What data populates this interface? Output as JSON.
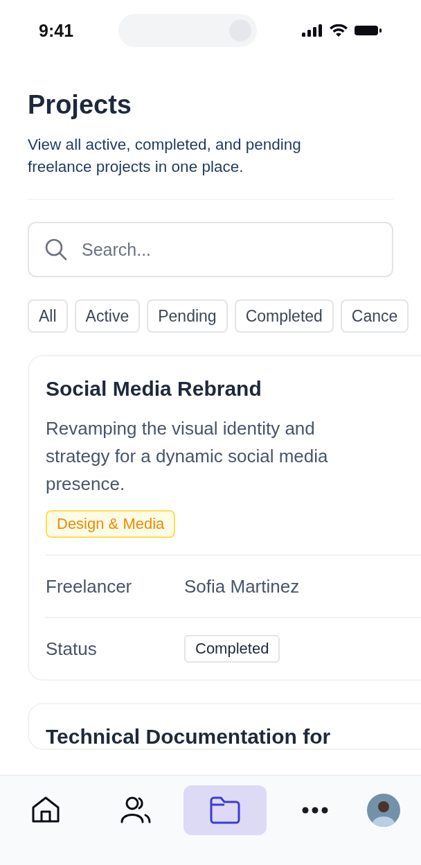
{
  "status_bar": {
    "time": "9:41"
  },
  "header": {
    "title": "Projects",
    "subtitle": "View all active, completed, and pending freelance projects in one place."
  },
  "search": {
    "placeholder": "Search..."
  },
  "filters": [
    "All",
    "Active",
    "Pending",
    "Completed",
    "Cance"
  ],
  "projects": [
    {
      "title": "Social Media Rebrand",
      "description": "Revamping the visual identity and strategy for a dynamic social media presence.",
      "category": "Design & Media",
      "fields": [
        {
          "kind": "text",
          "label": "Freelancer",
          "value": "Sofia Martinez"
        },
        {
          "kind": "badge",
          "label": "Status",
          "value": "Completed"
        }
      ]
    },
    {
      "title": "Technical Documentation for"
    }
  ],
  "nav": [
    {
      "kind": "home",
      "selected": false
    },
    {
      "kind": "people",
      "selected": false
    },
    {
      "kind": "folder",
      "selected": true
    },
    {
      "kind": "more",
      "selected": false
    },
    {
      "kind": "avatar",
      "selected": false
    }
  ]
}
